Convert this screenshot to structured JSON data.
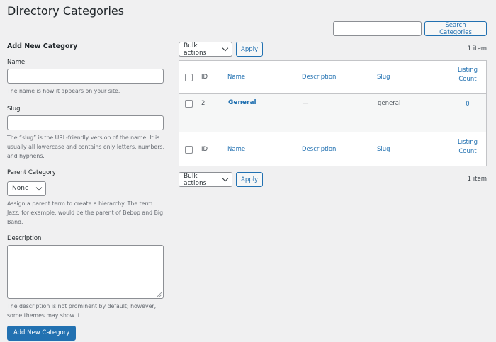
{
  "page": {
    "title": "Directory Categories"
  },
  "search": {
    "value": "",
    "button_label": "Search Categories"
  },
  "form": {
    "heading": "Add New Category",
    "name_label": "Name",
    "name_value": "",
    "name_help": "The name is how it appears on your site.",
    "slug_label": "Slug",
    "slug_value": "",
    "slug_help": "The “slug” is the URL-friendly version of the name. It is usually all lowercase and contains only letters, numbers, and hyphens.",
    "parent_label": "Parent Category",
    "parent_value": "None",
    "parent_help": "Assign a parent term to create a hierarchy. The term Jazz, for example, would be the parent of Bebop and Big Band.",
    "description_label": "Description",
    "description_value": "",
    "description_help": "The description is not prominent by default; however, some themes may show it.",
    "submit_label": "Add New Category"
  },
  "bulk_top": {
    "select_value": "Bulk actions",
    "apply_label": "Apply",
    "count": "1 item"
  },
  "bulk_bottom": {
    "select_value": "Bulk actions",
    "apply_label": "Apply",
    "count": "1 item"
  },
  "table": {
    "columns": {
      "id": "ID",
      "name": "Name",
      "description": "Description",
      "slug": "Slug",
      "listing_count_1": "Listing",
      "listing_count_2": "Count"
    },
    "rows": [
      {
        "id": "2",
        "name": "General",
        "description": "—",
        "slug": "general",
        "listing_count": "0"
      }
    ]
  },
  "colors": {
    "background": "#f0f0f1",
    "link": "#2271b1",
    "primary_button": "#2271b1",
    "border": "#c3c4c7"
  }
}
